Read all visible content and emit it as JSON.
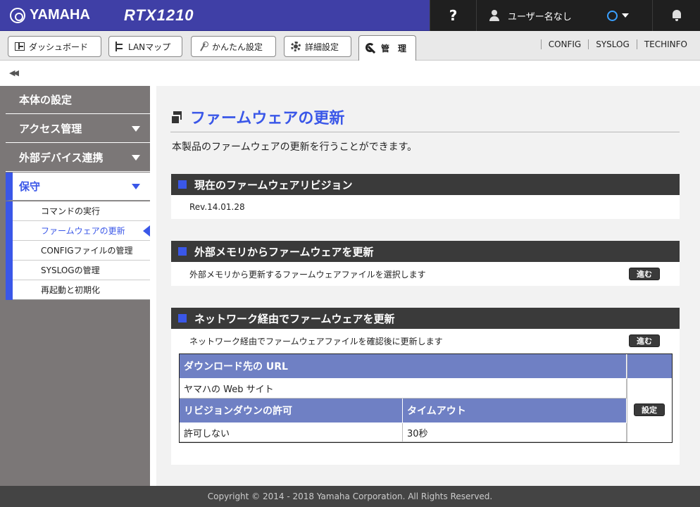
{
  "header": {
    "brand": "YAMAHA",
    "model": "RTX1210",
    "help": "?",
    "user": "ユーザー名なし"
  },
  "nav": {
    "tabs": [
      {
        "label": "ダッシュボード",
        "icon": "dashboard-icon"
      },
      {
        "label": "LANマップ",
        "icon": "lan-map-icon"
      },
      {
        "label": "かんたん設定",
        "icon": "wand-icon"
      },
      {
        "label": "詳細設定",
        "icon": "gear-icon"
      },
      {
        "label": "管　理",
        "icon": "wrench-icon"
      }
    ],
    "links": [
      "CONFIG",
      "SYSLOG",
      "TECHINFO"
    ]
  },
  "sidebar": {
    "items": [
      {
        "label": "本体の設定"
      },
      {
        "label": "アクセス管理"
      },
      {
        "label": "外部デバイス連携"
      },
      {
        "label": "保守"
      }
    ],
    "subitems": [
      {
        "label": "コマンドの実行"
      },
      {
        "label": "ファームウェアの更新"
      },
      {
        "label": "CONFIGファイルの管理"
      },
      {
        "label": "SYSLOGの管理"
      },
      {
        "label": "再起動と初期化"
      }
    ]
  },
  "main": {
    "title": "ファームウェアの更新",
    "description": "本製品のファームウェアの更新を行うことができます。",
    "current": {
      "heading": "現在のファームウェアリビジョン",
      "revision": "Rev.14.01.28"
    },
    "external": {
      "heading": "外部メモリからファームウェアを更新",
      "text": "外部メモリから更新するファームウェアファイルを選択します",
      "button": "進む"
    },
    "network": {
      "heading": "ネットワーク経由でファームウェアを更新",
      "text": "ネットワーク経由でファームウェアファイルを確認後に更新します",
      "button": "進む",
      "table": {
        "url_header": "ダウンロード先の URL",
        "url_value": "ヤマハの Web サイト",
        "downgrade_header": "リビジョンダウンの許可",
        "timeout_header": "タイムアウト",
        "downgrade_value": "許可しない",
        "timeout_value": "30秒",
        "set_button": "設定"
      }
    }
  },
  "footer": {
    "copyright": "Copyright © 2014 - 2018 Yamaha Corporation. All Rights Reserved."
  }
}
